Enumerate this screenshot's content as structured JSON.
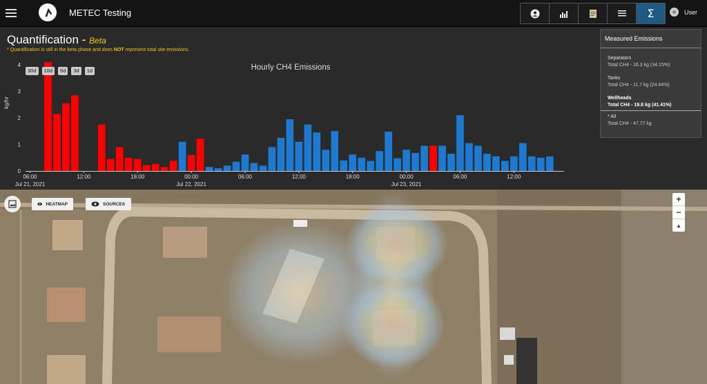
{
  "app": {
    "title": "METEC Testing"
  },
  "nav": {
    "items": [
      {
        "name": "nav-overview-button",
        "icon": "person-circle-icon",
        "active": false
      },
      {
        "name": "nav-charts-button",
        "icon": "bar-chart-icon",
        "active": false
      },
      {
        "name": "nav-document-button",
        "icon": "document-icon",
        "active": false
      },
      {
        "name": "nav-list-button",
        "icon": "list-icon",
        "active": false
      },
      {
        "name": "nav-quantification-button",
        "icon": "sigma-icon",
        "label": "Σ",
        "active": true
      }
    ]
  },
  "user": {
    "label": "User"
  },
  "quantification": {
    "title": "Quantification -",
    "beta": "Beta",
    "note_prefix": "* Quantification is still in the beta phase and does",
    "note_bold": "NOT",
    "note_suffix": "represent total site emissions."
  },
  "range_buttons": [
    "30d",
    "10d",
    "5d",
    "3d",
    "1d"
  ],
  "chart_data": {
    "type": "bar",
    "title": "Hourly CH4 Emissions",
    "ylabel": "kg/hr",
    "xlabel": "",
    "ylim": [
      0,
      4
    ],
    "yticks": [
      0,
      1,
      2,
      3,
      4
    ],
    "xticks": [
      {
        "label": "06:00",
        "sub": "Jul 21, 2021",
        "hour": 0
      },
      {
        "label": "12:00",
        "sub": "",
        "hour": 6
      },
      {
        "label": "18:00",
        "sub": "",
        "hour": 12
      },
      {
        "label": "00:00",
        "sub": "Jul 22, 2021",
        "hour": 18
      },
      {
        "label": "06:00",
        "sub": "",
        "hour": 24
      },
      {
        "label": "12:00",
        "sub": "",
        "hour": 30
      },
      {
        "label": "18:00",
        "sub": "",
        "hour": 36
      },
      {
        "label": "00:00",
        "sub": "Jul 23, 2021",
        "hour": 42
      },
      {
        "label": "06:00",
        "sub": "",
        "hour": 48
      },
      {
        "label": "12:00",
        "sub": "",
        "hour": 54
      }
    ],
    "series": [
      {
        "color": "#ff0000",
        "points": [
          [
            2,
            4.1
          ],
          [
            3,
            2.15
          ],
          [
            4,
            2.55
          ],
          [
            5,
            2.85
          ],
          [
            8,
            1.75
          ],
          [
            9,
            0.45
          ],
          [
            10,
            0.9
          ],
          [
            11,
            0.5
          ],
          [
            12,
            0.45
          ],
          [
            13,
            0.22
          ],
          [
            14,
            0.27
          ],
          [
            15,
            0.15
          ],
          [
            16,
            0.38
          ],
          [
            18,
            0.6
          ],
          [
            19,
            1.22
          ],
          [
            45,
            0.95
          ]
        ]
      },
      {
        "color": "#1e7ad1",
        "points": [
          [
            17,
            1.1
          ],
          [
            20,
            0.15
          ],
          [
            21,
            0.1
          ],
          [
            22,
            0.2
          ],
          [
            23,
            0.35
          ],
          [
            24,
            0.62
          ],
          [
            25,
            0.3
          ],
          [
            26,
            0.2
          ],
          [
            27,
            0.9
          ],
          [
            28,
            1.25
          ],
          [
            29,
            1.95
          ],
          [
            30,
            1.1
          ],
          [
            31,
            1.75
          ],
          [
            32,
            1.45
          ],
          [
            33,
            0.8
          ],
          [
            34,
            1.5
          ],
          [
            35,
            0.4
          ],
          [
            36,
            0.62
          ],
          [
            37,
            0.5
          ],
          [
            38,
            0.38
          ],
          [
            39,
            0.75
          ],
          [
            40,
            1.48
          ],
          [
            41,
            0.48
          ],
          [
            42,
            0.8
          ],
          [
            43,
            0.68
          ],
          [
            44,
            0.95
          ],
          [
            46,
            0.95
          ],
          [
            47,
            0.65
          ],
          [
            48,
            2.1
          ],
          [
            49,
            1.05
          ],
          [
            50,
            0.95
          ],
          [
            51,
            0.65
          ],
          [
            52,
            0.55
          ],
          [
            53,
            0.38
          ],
          [
            54,
            0.55
          ],
          [
            55,
            1.05
          ],
          [
            56,
            0.55
          ],
          [
            57,
            0.5
          ],
          [
            58,
            0.55
          ]
        ]
      }
    ]
  },
  "measured": {
    "title": "Measured Emissions",
    "items": [
      {
        "name": "Separators",
        "value": "Total CH4 - 16.3 kg (34.15%)",
        "bold": false
      },
      {
        "name": "Tanks",
        "value": "Total CH4 - 11.7 kg (24.44%)",
        "bold": false
      },
      {
        "name": "Wellheads",
        "value": "Total CH4 - 19.8 kg (41.41%)",
        "bold": true
      }
    ],
    "total": {
      "name": "* All",
      "value": "Total CH4 - 47.77 kg"
    }
  },
  "map": {
    "heatmap_label": "HEATMAP",
    "sources_label": "SOURCES",
    "zoom_in": "+",
    "zoom_out": "−",
    "reset": "▲"
  }
}
